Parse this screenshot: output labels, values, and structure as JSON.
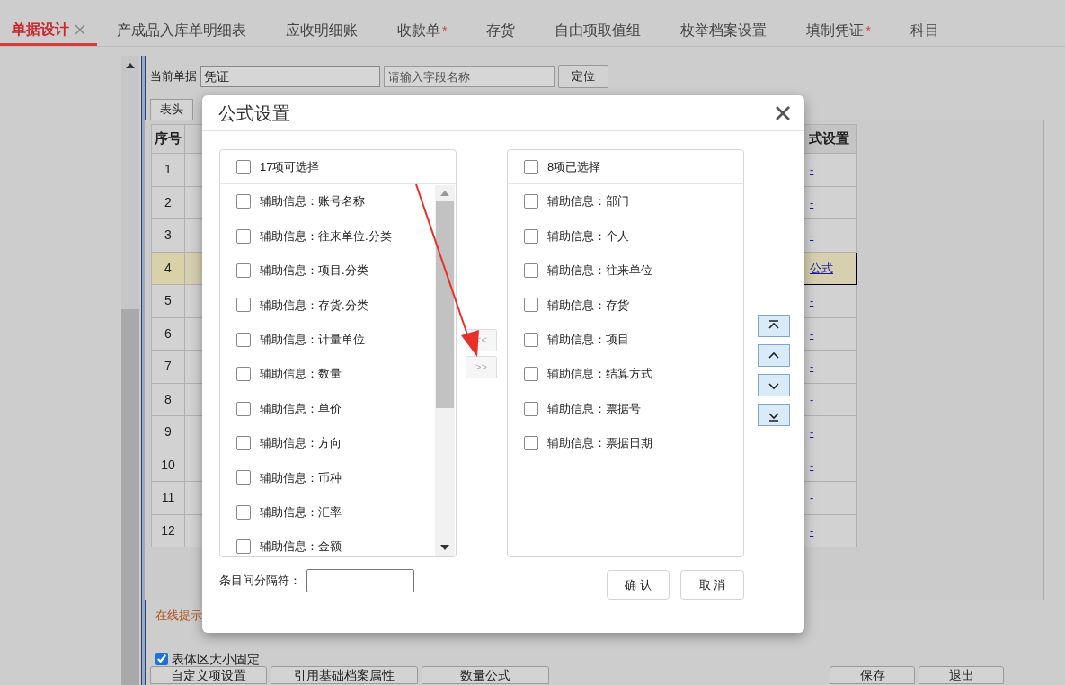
{
  "tabs": [
    {
      "label": "单据设计",
      "selected": true,
      "closable": true
    },
    {
      "label": "产成品入库单明细表",
      "selected": false,
      "closable": false
    },
    {
      "label": "应收明细账",
      "selected": false,
      "closable": false
    },
    {
      "label": "收款单",
      "selected": false,
      "closable": false,
      "mark": "*"
    },
    {
      "label": "存货",
      "selected": false,
      "closable": false
    },
    {
      "label": "自由项取值组",
      "selected": false,
      "closable": false
    },
    {
      "label": "枚举档案设置",
      "selected": false,
      "closable": false
    },
    {
      "label": "填制凭证",
      "selected": false,
      "closable": false,
      "mark": "*"
    },
    {
      "label": "科目",
      "selected": false,
      "closable": false
    }
  ],
  "toolbar": {
    "current_label": "当前单据",
    "current_value": "凭证",
    "field_placeholder": "请输入字段名称",
    "locate_button": "定位"
  },
  "section_tab": "表头",
  "table": {
    "columns": [
      "序号",
      "式设置"
    ],
    "rows": [
      {
        "no": "1",
        "formula": "-",
        "highlighted": false
      },
      {
        "no": "2",
        "formula": "-",
        "highlighted": false
      },
      {
        "no": "3",
        "formula": "-",
        "highlighted": false
      },
      {
        "no": "4",
        "formula": "公式",
        "highlighted": true
      },
      {
        "no": "5",
        "formula": "-",
        "highlighted": false
      },
      {
        "no": "6",
        "formula": "-",
        "highlighted": false
      },
      {
        "no": "7",
        "formula": "-",
        "highlighted": false
      },
      {
        "no": "8",
        "formula": "-",
        "highlighted": false
      },
      {
        "no": "9",
        "formula": "-",
        "highlighted": false
      },
      {
        "no": "10",
        "formula": "-",
        "highlighted": false
      },
      {
        "no": "11",
        "formula": "-",
        "highlighted": false
      },
      {
        "no": "12",
        "formula": "-",
        "highlighted": false
      }
    ]
  },
  "hint": "在线提示",
  "fixed_size": {
    "label": "表体区大小固定",
    "checked": true
  },
  "bottom_buttons": [
    "自定义项设置",
    "引用基础档案属性",
    "数量公式"
  ],
  "right_buttons": [
    "保存",
    "退出"
  ],
  "dialog": {
    "title": "公式设置",
    "available": {
      "header": "17项可选择",
      "checked": false,
      "items": [
        {
          "label": "辅助信息：账号名称",
          "checked": false
        },
        {
          "label": "辅助信息：往来单位.分类",
          "checked": false
        },
        {
          "label": "辅助信息：项目.分类",
          "checked": false
        },
        {
          "label": "辅助信息：存货.分类",
          "checked": false
        },
        {
          "label": "辅助信息：计量单位",
          "checked": false
        },
        {
          "label": "辅助信息：数量",
          "checked": false
        },
        {
          "label": "辅助信息：单价",
          "checked": false
        },
        {
          "label": "辅助信息：方向",
          "checked": false
        },
        {
          "label": "辅助信息：币种",
          "checked": false
        },
        {
          "label": "辅助信息：汇率",
          "checked": false
        },
        {
          "label": "辅助信息：金额",
          "checked": false
        }
      ]
    },
    "chosen": {
      "header": "8项已选择",
      "checked": false,
      "items": [
        {
          "label": "辅助信息：部门",
          "checked": false
        },
        {
          "label": "辅助信息：个人",
          "checked": false
        },
        {
          "label": "辅助信息：往来单位",
          "checked": false
        },
        {
          "label": "辅助信息：存货",
          "checked": false
        },
        {
          "label": "辅助信息：项目",
          "checked": false
        },
        {
          "label": "辅助信息：结算方式",
          "checked": false
        },
        {
          "label": "辅助信息：票据号",
          "checked": false
        },
        {
          "label": "辅助信息：票据日期",
          "checked": false
        }
      ]
    },
    "move_buttons": [
      {
        "label": "<<",
        "disabled": true
      },
      {
        "label": ">>",
        "disabled": true
      }
    ],
    "order_buttons": [
      {
        "kind": "top"
      },
      {
        "kind": "up"
      },
      {
        "kind": "down"
      },
      {
        "kind": "bottom"
      }
    ],
    "separator_label": "条目间分隔符：",
    "confirm": "确 认",
    "cancel": "取 消"
  }
}
